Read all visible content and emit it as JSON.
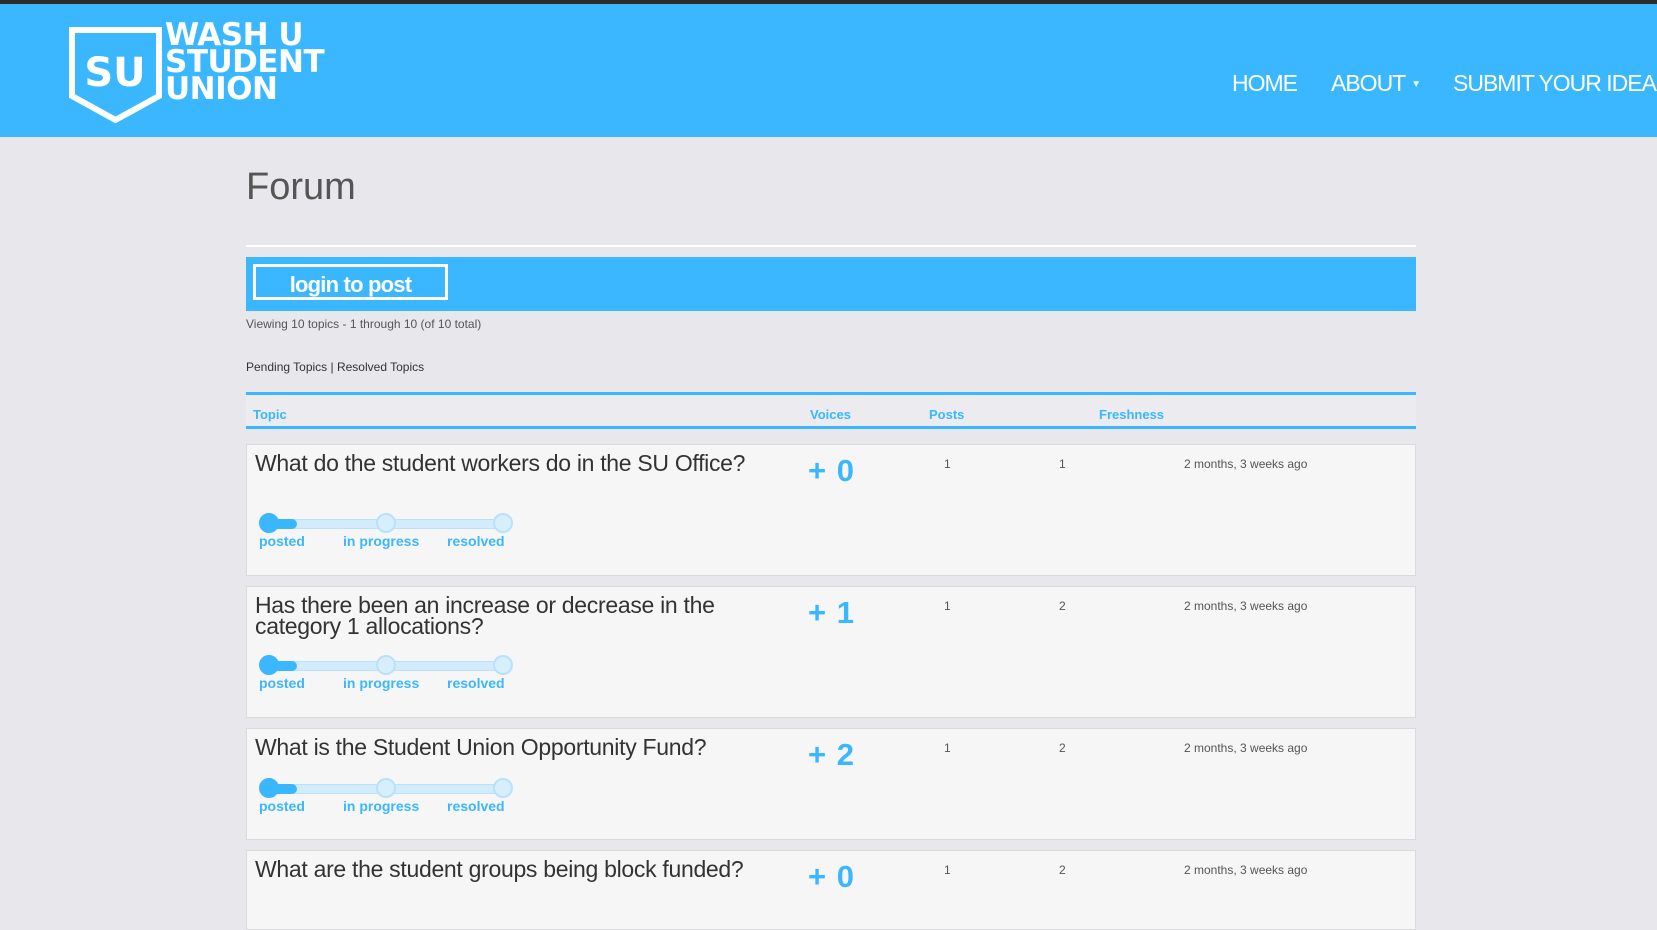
{
  "header": {
    "logo_initials": "SU",
    "logo_lines": [
      "WASH U",
      "STUDENT",
      "UNION"
    ],
    "nav": {
      "home": "HOME",
      "about": "ABOUT",
      "about_caret": "▼",
      "submit": "SUBMIT YOUR IDEA"
    }
  },
  "page": {
    "title": "Forum",
    "login_button": "login to post",
    "viewing_text": "Viewing 10 topics - 1 through 10 (of 10 total)",
    "filters": {
      "pending": "Pending Topics",
      "separator": " | ",
      "resolved": "Resolved Topics"
    }
  },
  "table": {
    "headers": {
      "topic": "Topic",
      "voices": "Voices",
      "posts": "Posts",
      "freshness": "Freshness"
    },
    "stages": {
      "posted": "posted",
      "in_progress": "in progress",
      "resolved": "resolved"
    },
    "rows": [
      {
        "title": "What do the student workers do in the SU Office?",
        "votes": "+ 0",
        "voices": "1",
        "posts": "1",
        "freshness": "2 months, 3 weeks ago",
        "progress": 0
      },
      {
        "title": "Has there been an increase or decrease in the category 1 allocations?",
        "votes": "+ 1",
        "voices": "1",
        "posts": "2",
        "freshness": "2 months, 3 weeks ago",
        "progress": 0
      },
      {
        "title": "What is the Student Union Opportunity Fund?",
        "votes": "+ 2",
        "voices": "1",
        "posts": "2",
        "freshness": "2 months, 3 weeks ago",
        "progress": 0
      },
      {
        "title": "What are the student groups being block funded?",
        "votes": "+ 0",
        "voices": "1",
        "posts": "2",
        "freshness": "2 months, 3 weeks ago",
        "progress": 0
      }
    ]
  },
  "colors": {
    "accent": "#3ab7ff",
    "background": "#e8e8ec",
    "row_bg": "#f6f6f6"
  }
}
